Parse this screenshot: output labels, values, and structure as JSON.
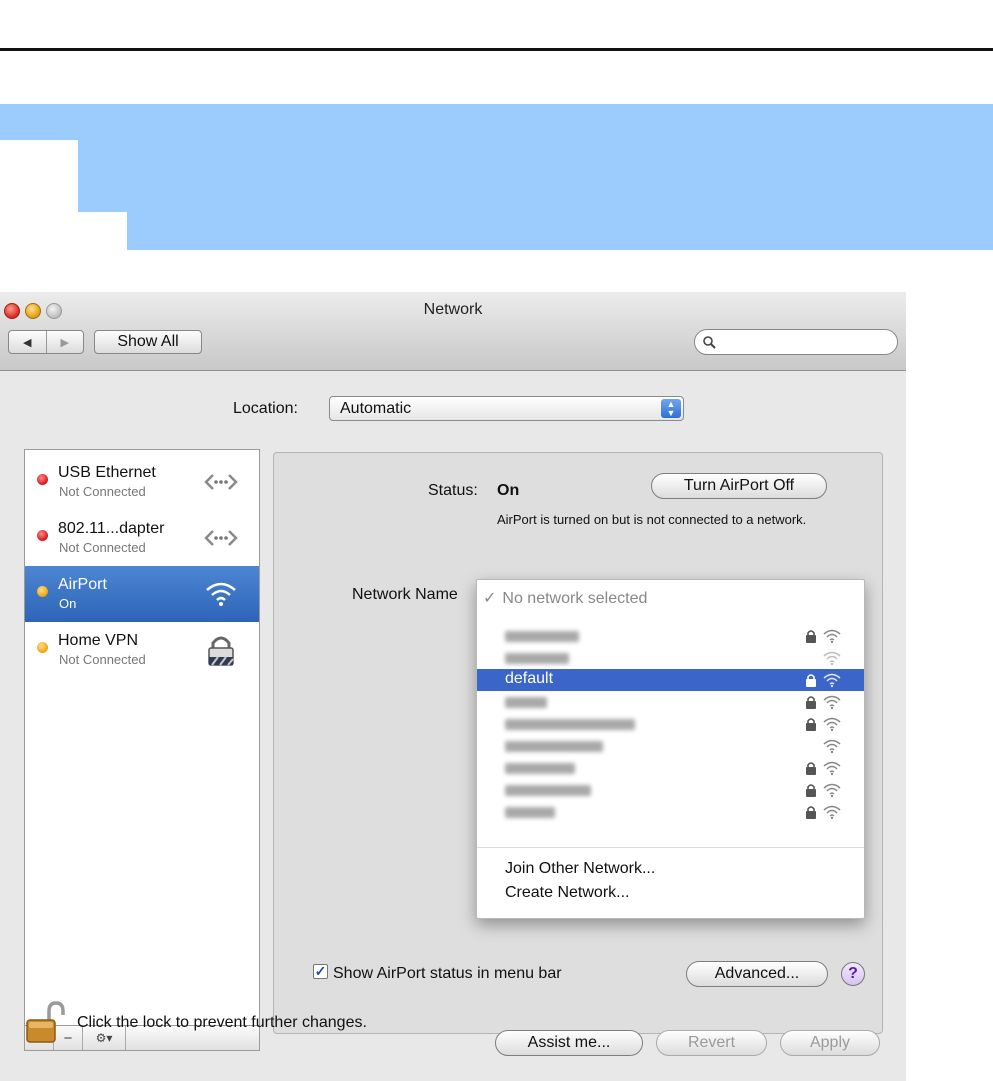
{
  "window": {
    "title": "Network",
    "show_all_label": "Show All",
    "search_value": "",
    "nav_back_glyph": "◀",
    "nav_forward_glyph": "▶",
    "search_icon": "magnifier-icon"
  },
  "location": {
    "label": "Location:",
    "value": "Automatic"
  },
  "services": [
    {
      "name": "USB Ethernet",
      "status": "Not Connected",
      "dot": "red",
      "icon": "ethernet-arrows-icon"
    },
    {
      "name": "802.11...dapter",
      "status": "Not Connected",
      "dot": "red",
      "icon": "ethernet-arrows-icon"
    },
    {
      "name": "AirPort",
      "status": "On",
      "dot": "orange",
      "icon": "wifi-icon",
      "selected": true
    },
    {
      "name": "Home VPN",
      "status": "Not Connected",
      "dot": "orange",
      "icon": "vpn-lock-icon"
    }
  ],
  "list_tools": {
    "add": "+",
    "remove": "−",
    "gear": "⚙▾"
  },
  "status": {
    "label": "Status:",
    "value": "On",
    "description": "AirPort is turned on but is not connected to a network.",
    "toggle_label": "Turn AirPort Off"
  },
  "network_name": {
    "label": "Network Name",
    "menu": {
      "header_check": "✓",
      "header": "No network selected",
      "networks": [
        {
          "name": "",
          "locked": true
        },
        {
          "name": "",
          "locked": false
        },
        {
          "name": "default",
          "locked": true,
          "highlighted": true
        },
        {
          "name": "",
          "locked": true
        },
        {
          "name": "",
          "locked": true
        },
        {
          "name": "",
          "locked": false
        },
        {
          "name": "",
          "locked": true
        },
        {
          "name": "",
          "locked": true
        },
        {
          "name": "",
          "locked": true
        }
      ],
      "join_other": "Join Other Network...",
      "create": "Create Network..."
    }
  },
  "menu_bar_option": {
    "checked": true,
    "check_glyph": "✓",
    "label": "Show AirPort status in menu bar"
  },
  "buttons": {
    "advanced": "Advanced...",
    "help": "?",
    "assist": "Assist me...",
    "revert": "Revert",
    "apply": "Apply"
  },
  "lock_text": "Click the lock to prevent further changes.",
  "colors": {
    "highlight_band": "#9ccbfd",
    "selection": "#3b65c8",
    "status_red": "#d41414",
    "status_orange": "#f2a00c"
  }
}
